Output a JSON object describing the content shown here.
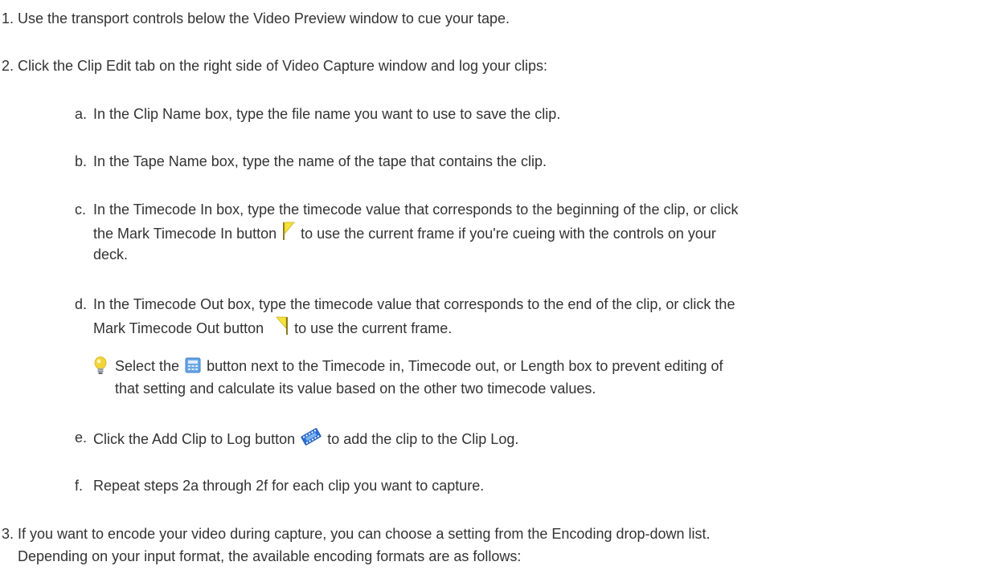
{
  "steps": [
    {
      "num": "1.",
      "text": "Use the transport controls below the Video Preview window to cue your tape."
    },
    {
      "num": "2.",
      "text": "Click the Clip Edit tab on the right side of Video Capture window and log your clips:"
    },
    {
      "num": "3.",
      "line1": "If you want to encode your video during capture, you can choose a setting from the Encoding drop-down list.",
      "line2": "Depending on your input format, the available encoding formats are as follows:"
    }
  ],
  "substeps": {
    "a": {
      "letter": "a.",
      "text": "In the Clip Name box, type the file name you want to use to save the clip."
    },
    "b": {
      "letter": "b.",
      "text": "In the Tape Name box, type the name of the tape that contains the clip."
    },
    "c": {
      "letter": "c.",
      "line1": "In the Timecode In box, type the timecode value that corresponds to the beginning of the clip, or click",
      "line2_before": "the Mark Timecode In button",
      "line2_after": " to use the current frame if you're cueing with the controls on your",
      "line3": "deck."
    },
    "d": {
      "letter": "d.",
      "line1": "In the Timecode Out box, type the timecode value that corresponds to the end of the clip, or click the",
      "line2_before": "Mark Timecode Out button",
      "line2_after": "to use the current frame."
    },
    "tip": {
      "line1_before": "Select the",
      "line1_after": "button next to the Timecode in, Timecode out, or Length box to prevent editing of",
      "line2": "that setting and calculate its value based on the other two timecode values."
    },
    "e": {
      "letter": "e.",
      "before": "Click the Add Clip to Log button",
      "after": "to add the clip to the Clip Log."
    },
    "f": {
      "letter": "f.",
      "text": "Repeat steps 2a through 2f for each clip you want to capture."
    }
  },
  "icons": {
    "mark_in": "mark-timecode-in-icon",
    "mark_out": "mark-timecode-out-icon",
    "tip": "lightbulb-tip-icon",
    "calc": "calculator-lock-icon",
    "add_clip": "add-clip-to-log-icon"
  },
  "colors": {
    "text": "#333333",
    "flag_yellow": "#f5e23a",
    "bulb_yellow": "#f2d43a",
    "calc_blue": "#6aa6e6",
    "clip_blue": "#2a6fd6"
  }
}
